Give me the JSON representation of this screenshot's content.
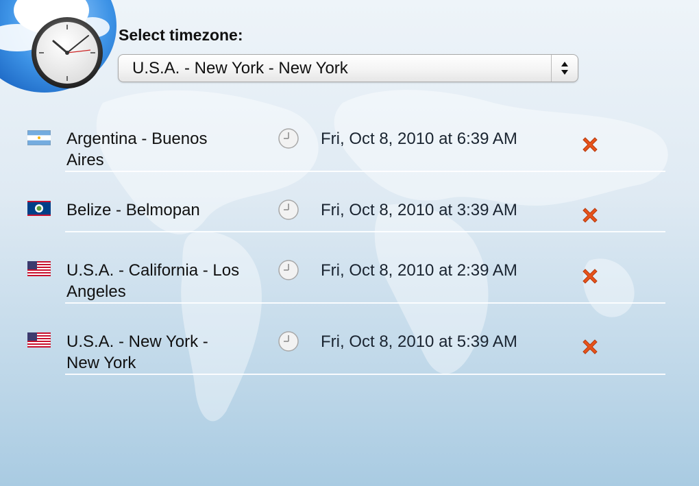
{
  "header": {
    "select_label": "Select timezone:",
    "selected_timezone": "U.S.A. - New York - New York"
  },
  "zones": [
    {
      "place": "Argentina - Buenos Aires",
      "flag": "argentina-flag-icon",
      "time": "Fri, Oct 8, 2010 at 6:39 AM"
    },
    {
      "place": "Belize - Belmopan",
      "flag": "belize-flag-icon",
      "time": "Fri, Oct 8, 2010 at 3:39 AM"
    },
    {
      "place": "U.S.A. - California - Los Angeles",
      "flag": "usa-flag-icon",
      "time": "Fri, Oct 8, 2010 at 2:39 AM"
    },
    {
      "place": "U.S.A. - New York - New York",
      "flag": "usa-flag-icon",
      "time": "Fri, Oct 8, 2010 at 5:39 AM"
    }
  ],
  "colors": {
    "remove": "#e8531b",
    "background_top": "#eef4f9",
    "background_bottom": "#a9cbe2"
  }
}
